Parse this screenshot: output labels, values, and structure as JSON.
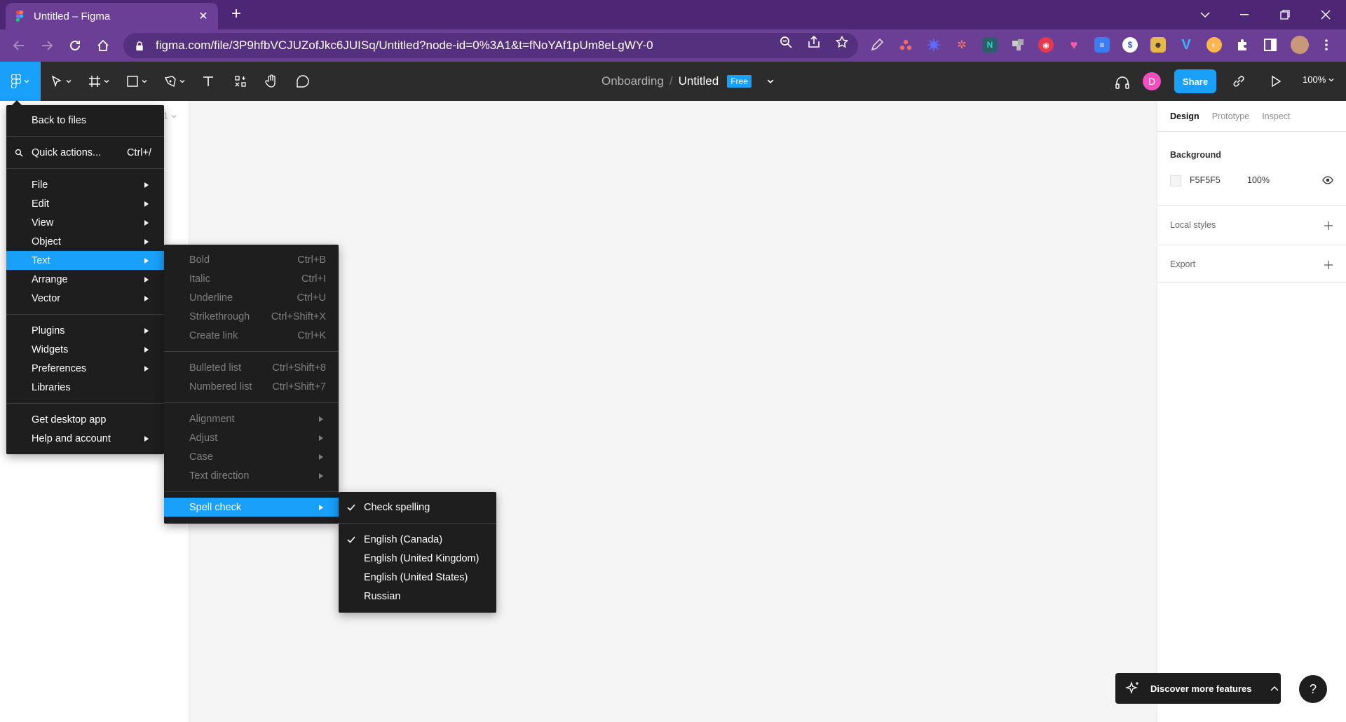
{
  "browser": {
    "tab_title": "Untitled – Figma",
    "url": "figma.com/file/3P9hfbVCJUZofJkc6JUISq/Untitled?node-id=0%3A1&t=fNoYAf1pUm8eLgWY-0"
  },
  "figma": {
    "breadcrumb": {
      "project": "Onboarding",
      "separator": "/",
      "file": "Untitled",
      "plan_badge": "Free"
    },
    "avatar_letter": "D",
    "share_label": "Share",
    "zoom": "100%"
  },
  "right_panel": {
    "tabs": [
      "Design",
      "Prototype",
      "Inspect"
    ],
    "background_title": "Background",
    "background_hex": "F5F5F5",
    "background_opacity": "100%",
    "local_styles": "Local styles",
    "export": "Export"
  },
  "main_menu": {
    "back": "Back to files",
    "quick_actions": "Quick actions...",
    "quick_actions_shortcut": "Ctrl+/",
    "items": [
      "File",
      "Edit",
      "View",
      "Object",
      "Text",
      "Arrange",
      "Vector"
    ],
    "items2": [
      "Plugins",
      "Widgets",
      "Preferences",
      "Libraries"
    ],
    "items3": [
      "Get desktop app",
      "Help and account"
    ]
  },
  "text_menu": {
    "format": [
      {
        "label": "Bold",
        "shortcut": "Ctrl+B"
      },
      {
        "label": "Italic",
        "shortcut": "Ctrl+I"
      },
      {
        "label": "Underline",
        "shortcut": "Ctrl+U"
      },
      {
        "label": "Strikethrough",
        "shortcut": "Ctrl+Shift+X"
      },
      {
        "label": "Create link",
        "shortcut": "Ctrl+K"
      }
    ],
    "lists": [
      {
        "label": "Bulleted list",
        "shortcut": "Ctrl+Shift+8"
      },
      {
        "label": "Numbered list",
        "shortcut": "Ctrl+Shift+7"
      }
    ],
    "submenus": [
      "Alignment",
      "Adjust",
      "Case",
      "Text direction"
    ],
    "spell_check": "Spell check"
  },
  "spell_menu": {
    "check_spelling": "Check spelling",
    "languages": [
      "English (Canada)",
      "English (United Kingdom)",
      "English (United States)",
      "Russian"
    ]
  },
  "discover": {
    "label": "Discover more features"
  },
  "help": "?",
  "layers_page_fragment": "1"
}
